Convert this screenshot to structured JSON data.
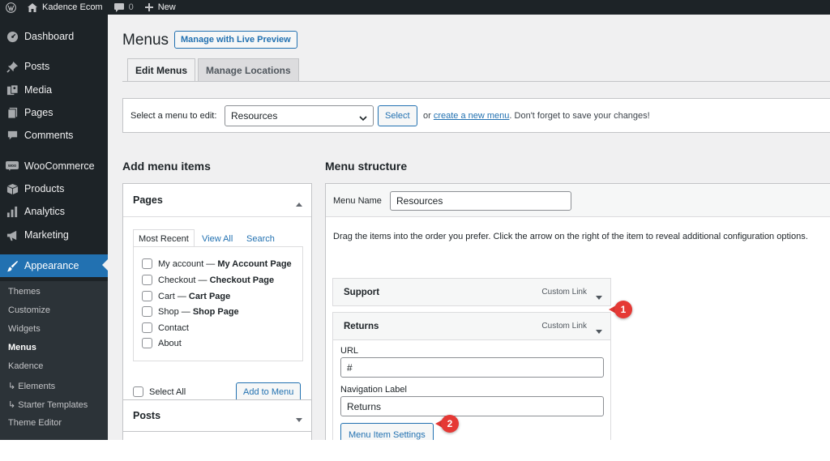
{
  "colors": {
    "admin_bar": "#1d2327",
    "sidebar": "#1d2327",
    "submenu": "#2c3338",
    "accent": "#2271b1",
    "background": "#f0f0f1",
    "callout": "#e53935"
  },
  "admin_bar": {
    "logo_icon": "wordpress-logo-icon",
    "site_icon": "home-icon",
    "site_name": "Kadence Ecom",
    "comments_icon": "comment-bubble-icon",
    "comments_count": "0",
    "new_icon": "plus-icon",
    "new_label": "New"
  },
  "sidebar": {
    "items": [
      {
        "label": "Dashboard",
        "icon": "dashboard-gauge-icon"
      },
      {
        "label": "Posts",
        "icon": "pushpin-icon"
      },
      {
        "label": "Media",
        "icon": "media-icon"
      },
      {
        "label": "Pages",
        "icon": "pages-icon"
      },
      {
        "label": "Comments",
        "icon": "comment-icon"
      },
      {
        "label": "WooCommerce",
        "icon": "woocommerce-icon"
      },
      {
        "label": "Products",
        "icon": "products-box-icon"
      },
      {
        "label": "Analytics",
        "icon": "bar-chart-icon"
      },
      {
        "label": "Marketing",
        "icon": "megaphone-icon"
      },
      {
        "label": "Appearance",
        "icon": "paintbrush-icon"
      }
    ],
    "submenu": [
      {
        "label": "Themes"
      },
      {
        "label": "Customize"
      },
      {
        "label": "Widgets"
      },
      {
        "label": "Menus"
      },
      {
        "label": "Kadence"
      },
      {
        "label": "↳ Elements"
      },
      {
        "label": "↳ Starter Templates"
      },
      {
        "label": "Theme Editor"
      }
    ]
  },
  "header": {
    "title": "Menus",
    "live_preview_label": "Manage with Live Preview"
  },
  "tabs": [
    {
      "label": "Edit Menus",
      "active": true
    },
    {
      "label": "Manage Locations",
      "active": false
    }
  ],
  "select_bar": {
    "label": "Select a menu to edit:",
    "selected_menu": "Resources",
    "select_button": "Select",
    "hint_or": "or",
    "create_link": "create a new menu",
    "hint_tail": ". Don't forget to save your changes!"
  },
  "add_menu_items": {
    "heading": "Add menu items",
    "pages_title": "Pages",
    "pages_tabs": [
      "Most Recent",
      "View All",
      "Search"
    ],
    "pages": [
      {
        "title": "My account",
        "state": "My Account Page"
      },
      {
        "title": "Checkout",
        "state": "Checkout Page"
      },
      {
        "title": "Cart",
        "state": "Cart Page"
      },
      {
        "title": "Shop",
        "state": "Shop Page"
      },
      {
        "title": "Contact",
        "state": ""
      },
      {
        "title": "About",
        "state": ""
      }
    ],
    "select_all_label": "Select All",
    "add_button": "Add to Menu",
    "posts_title": "Posts"
  },
  "menu_structure": {
    "heading": "Menu structure",
    "name_label": "Menu Name",
    "name_value": "Resources",
    "drag_hint": "Drag the items into the order you prefer. Click the arrow on the right of the item to reveal additional configuration options.",
    "items": [
      {
        "title": "Support",
        "type": "Custom Link"
      },
      {
        "title": "Returns",
        "type": "Custom Link"
      }
    ],
    "returns_fields": {
      "url_label": "URL",
      "url_value": "#",
      "nav_label": "Navigation Label",
      "nav_value": "Returns"
    },
    "settings_button": "Menu Item Settings"
  },
  "callouts": [
    "1",
    "2"
  ]
}
